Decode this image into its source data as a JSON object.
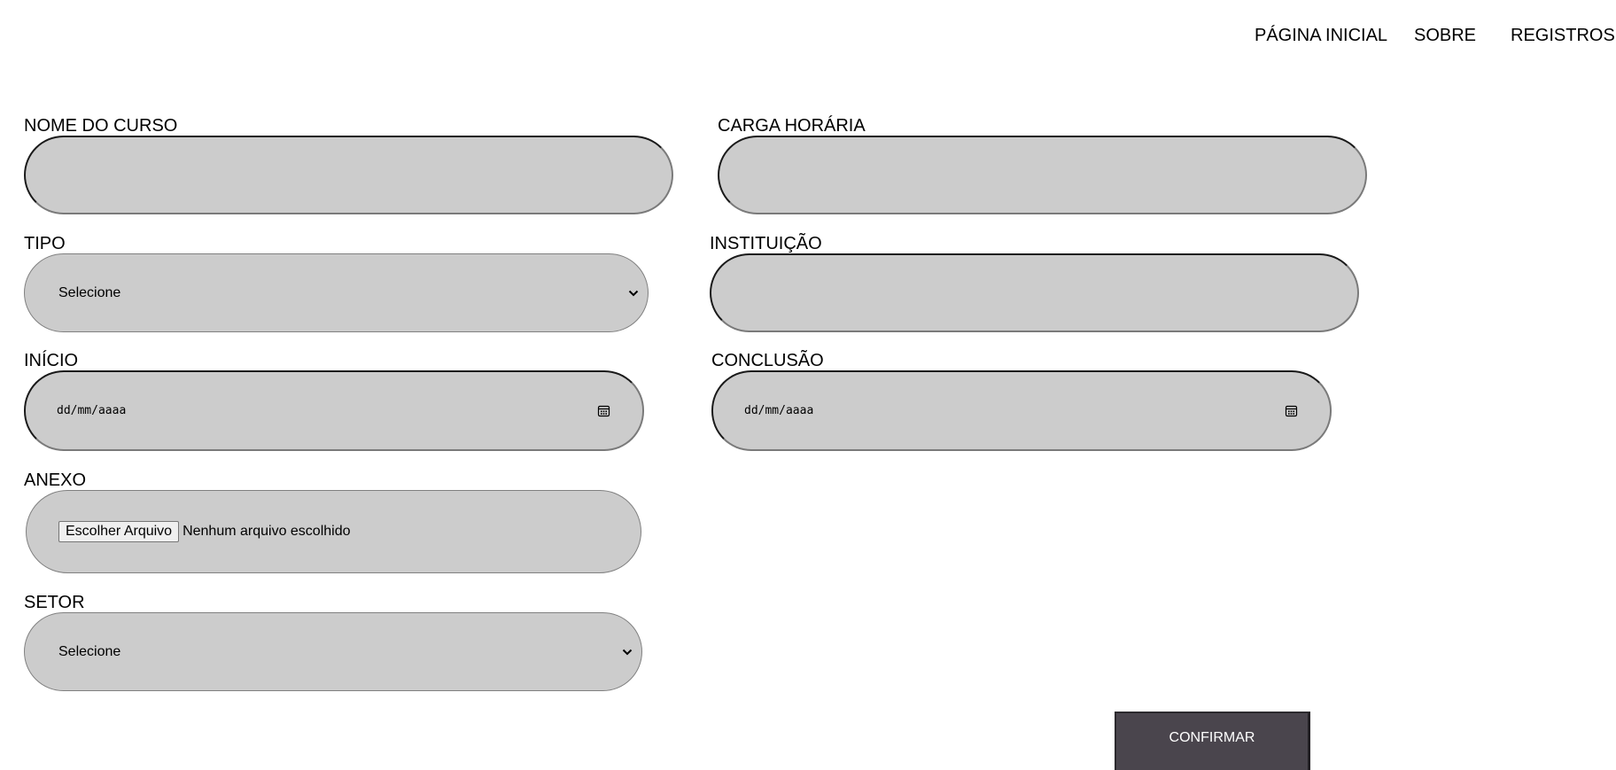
{
  "nav": {
    "home_label": "PÁGINA INICIAL",
    "about_label": "SOBRE",
    "records_label": "REGISTROS"
  },
  "form": {
    "course_name": {
      "label": "NOME DO CURSO",
      "value": ""
    },
    "workload": {
      "label": "CARGA HORÁRIA",
      "value": ""
    },
    "type": {
      "label": "TIPO",
      "selected": "Selecione"
    },
    "institution": {
      "label": "INSTITUIÇÃO",
      "value": ""
    },
    "start": {
      "label": "INÍCIO",
      "placeholder": "dd/mm/aaaa"
    },
    "end": {
      "label": "CONCLUSÃO",
      "placeholder": "dd/mm/aaaa"
    },
    "attachment": {
      "label": "ANEXO",
      "button_label": "Escolher Arquivo",
      "status": "Nenhum arquivo escolhido"
    },
    "sector": {
      "label": "SETOR",
      "selected": "Selecione"
    },
    "confirm_label": "CONFIRMAR"
  },
  "icons": {
    "select_arrow": "chevron-down-icon",
    "date_picker": "calendar-icon"
  },
  "colors": {
    "field_background": "#cccccc",
    "confirm_background": "#4a454d",
    "confirm_text": "#ffffff"
  }
}
